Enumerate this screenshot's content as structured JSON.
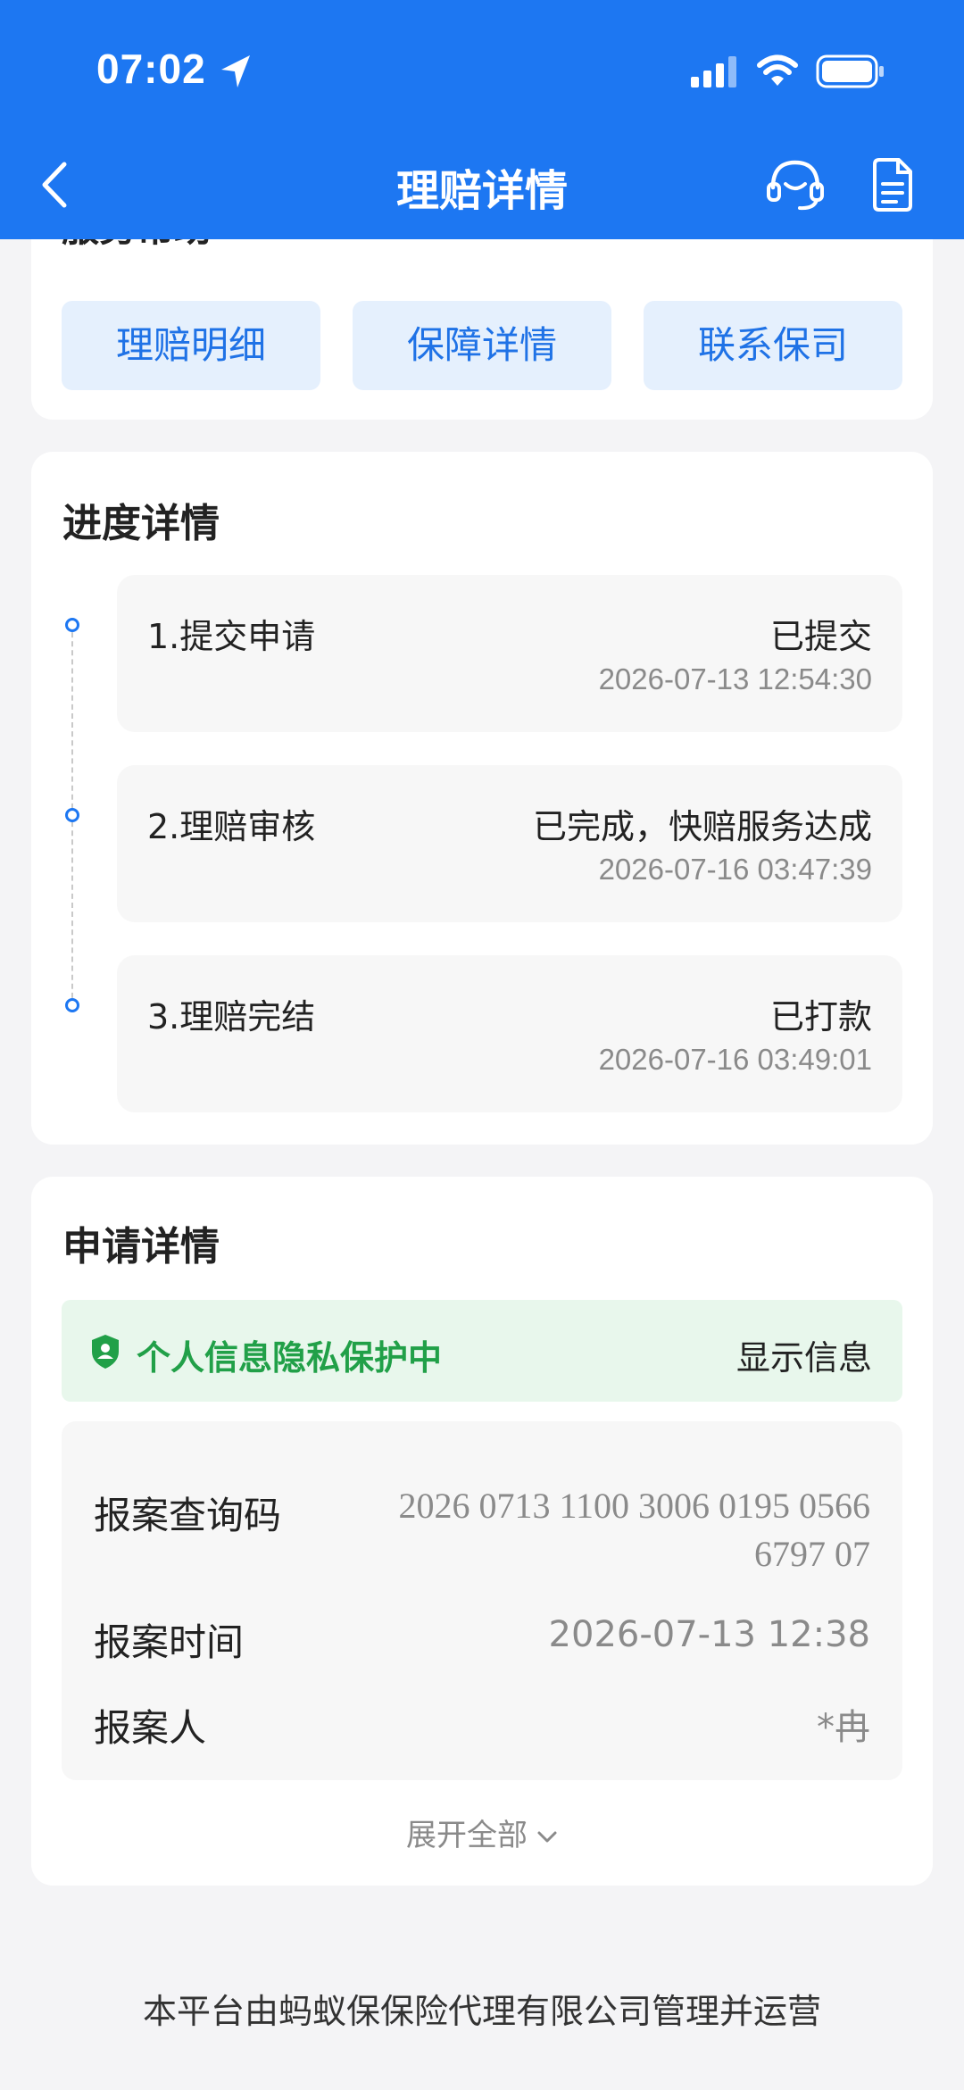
{
  "status_bar": {
    "time": "07:02"
  },
  "nav": {
    "title": "理赔详情"
  },
  "service_help": {
    "title": "服务帮助",
    "buttons": [
      "理赔明细",
      "保障详情",
      "联系保司"
    ]
  },
  "progress": {
    "title": "进度详情",
    "steps": [
      {
        "name": "1.提交申请",
        "status": "已提交",
        "time": "2026-07-13 12:54:30"
      },
      {
        "name": "2.理赔审核",
        "status": "已完成，快赔服务达成",
        "time": "2026-07-16 03:47:39"
      },
      {
        "name": "3.理赔完结",
        "status": "已打款",
        "time": "2026-07-16 03:49:01"
      }
    ]
  },
  "apply": {
    "title": "申请详情",
    "privacy_text": "个人信息隐私保护中",
    "show_info": "显示信息",
    "fields": [
      {
        "label": "报案查询码",
        "value": "2026 0713 1100 3006 0195 0566 6797 07"
      },
      {
        "label": "报案时间",
        "value": "2026-07-13 12:38"
      },
      {
        "label": "报案人",
        "value": "*冉"
      }
    ],
    "expand": "展开全部"
  },
  "footer": "本平台由蚂蚁保保险代理有限公司管理并运营"
}
